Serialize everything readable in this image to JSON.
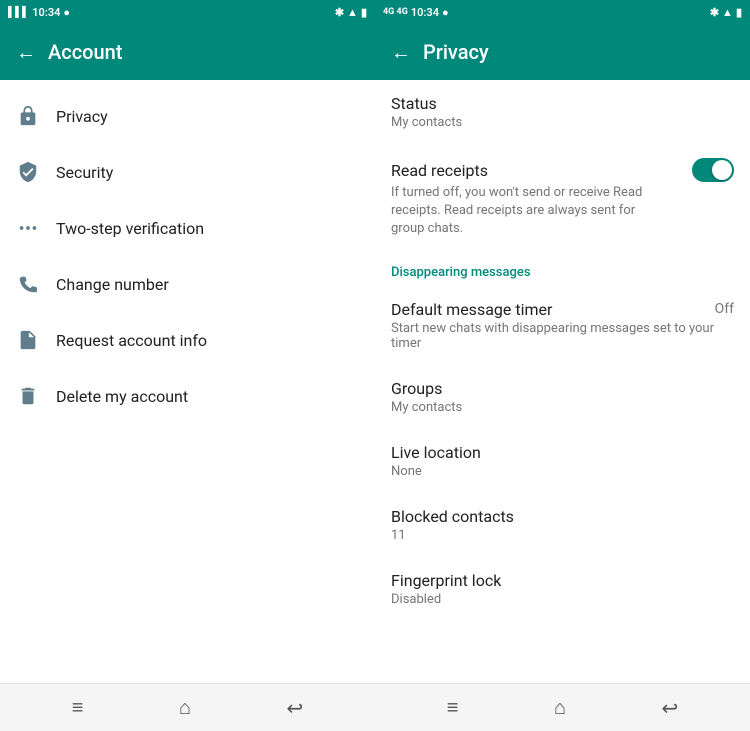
{
  "account_panel": {
    "status_bar": {
      "time": "10:34",
      "left_icons": [
        "signal",
        "wifi",
        "dot"
      ],
      "right_icons": [
        "bluetooth",
        "wifi2",
        "battery"
      ]
    },
    "header": {
      "title": "Account",
      "back_label": "←"
    },
    "menu_items": [
      {
        "id": "privacy",
        "label": "Privacy",
        "icon": "lock"
      },
      {
        "id": "security",
        "label": "Security",
        "icon": "shield"
      },
      {
        "id": "two-step",
        "label": "Two-step verification",
        "icon": "dots"
      },
      {
        "id": "change-number",
        "label": "Change number",
        "icon": "phone-edit"
      },
      {
        "id": "request-info",
        "label": "Request account info",
        "icon": "file"
      },
      {
        "id": "delete-account",
        "label": "Delete my account",
        "icon": "trash"
      }
    ],
    "bottom_nav": [
      "≡",
      "⌂",
      "↩"
    ]
  },
  "privacy_panel": {
    "status_bar": {
      "time": "10:34",
      "left_icons": [
        "4g",
        "4g",
        "dot"
      ],
      "right_icons": [
        "bluetooth",
        "wifi2",
        "battery"
      ]
    },
    "header": {
      "title": "Privacy",
      "back_label": "←"
    },
    "items": [
      {
        "id": "status",
        "label": "Status",
        "sub": "My contacts",
        "type": "simple",
        "right": ""
      },
      {
        "id": "read-receipts",
        "label": "Read receipts",
        "sub": "If turned off, you won't send or receive Read receipts. Read receipts are always sent for group chats.",
        "type": "toggle",
        "toggled": true
      },
      {
        "id": "disappearing-header",
        "label": "Disappearing messages",
        "type": "section"
      },
      {
        "id": "default-timer",
        "label": "Default message timer",
        "sub": "Start new chats with disappearing messages set to your timer",
        "type": "right-value",
        "right": "Off"
      },
      {
        "id": "groups",
        "label": "Groups",
        "sub": "My contacts",
        "type": "simple",
        "right": ""
      },
      {
        "id": "live-location",
        "label": "Live location",
        "sub": "None",
        "type": "simple",
        "right": ""
      },
      {
        "id": "blocked-contacts",
        "label": "Blocked contacts",
        "sub": "11",
        "type": "simple",
        "right": ""
      },
      {
        "id": "fingerprint-lock",
        "label": "Fingerprint lock",
        "sub": "Disabled",
        "type": "simple",
        "right": ""
      }
    ],
    "bottom_nav": [
      "≡",
      "⌂",
      "↩"
    ]
  }
}
